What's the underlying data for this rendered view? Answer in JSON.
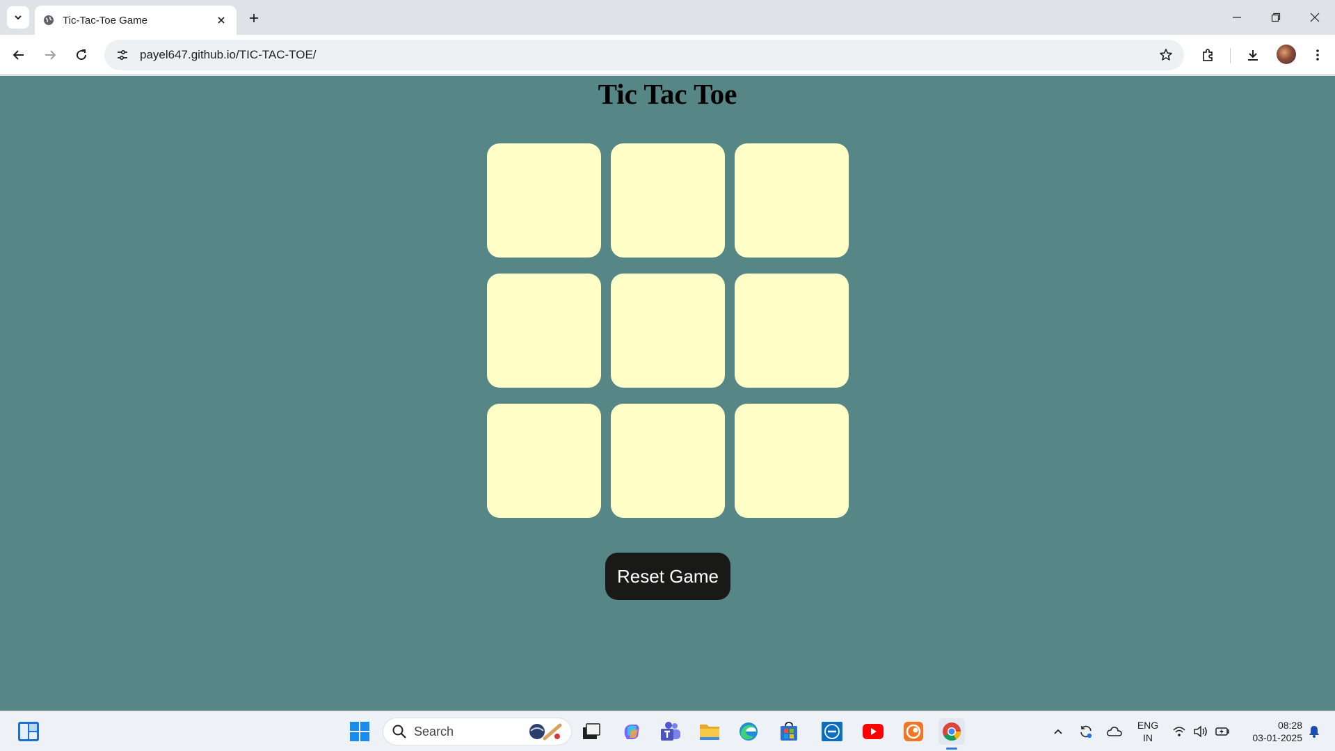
{
  "browser": {
    "tab_title": "Tic-Tac-Toe Game",
    "url": "payel647.github.io/TIC-TAC-TOE/"
  },
  "page": {
    "title": "Tic Tac Toe",
    "board": [
      "",
      "",
      "",
      "",
      "",
      "",
      "",
      "",
      ""
    ],
    "reset_label": "Reset Game",
    "colors": {
      "background": "#568686",
      "cell": "#ffffc8",
      "button": "#191a18"
    }
  },
  "taskbar": {
    "search_label": "Search",
    "language": "ENG",
    "region": "IN",
    "time": "08:28",
    "date": "03-01-2025",
    "apps": [
      "widgets-icon",
      "start-icon",
      "task-view-icon",
      "copilot-icon",
      "teams-icon",
      "file-explorer-icon",
      "edge-icon",
      "store-icon",
      "dell-icon",
      "youtube-icon",
      "crunchyroll-icon",
      "chrome-icon"
    ]
  }
}
